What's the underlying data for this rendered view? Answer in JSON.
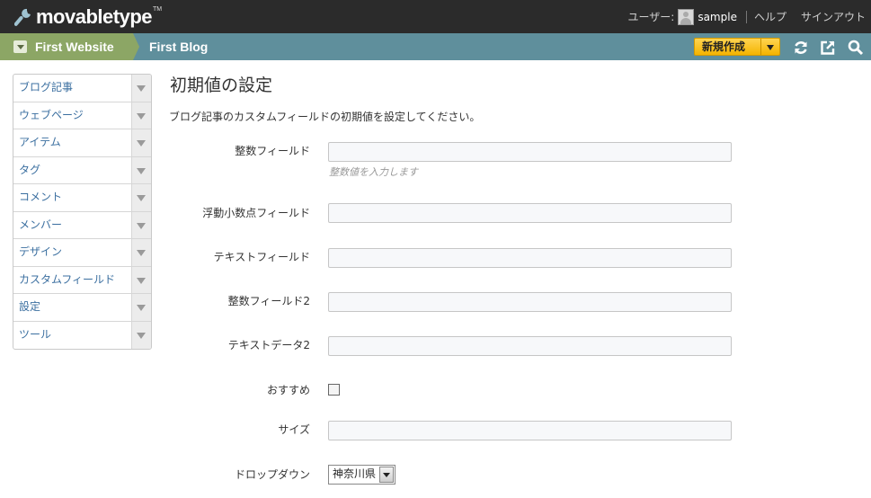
{
  "app": {
    "logo_text": "movabletype",
    "logo_tm": "TM"
  },
  "user_bar": {
    "user_label": "ユーザー:",
    "user_name": "sample",
    "help_label": "ヘルプ",
    "signout_label": "サインアウト"
  },
  "nav": {
    "website_name": "First Website",
    "blog_name": "First Blog",
    "new_button_label": "新規作成",
    "icons": [
      "refresh-icon",
      "external-link-icon",
      "search-icon"
    ],
    "colors": {
      "website_bg": "#8ca665",
      "blog_bg": "#5f8f9c",
      "new_button_bg": "#f4b400"
    }
  },
  "sidebar": {
    "items": [
      {
        "label": "ブログ記事"
      },
      {
        "label": "ウェブページ"
      },
      {
        "label": "アイテム"
      },
      {
        "label": "タグ"
      },
      {
        "label": "コメント"
      },
      {
        "label": "メンバー"
      },
      {
        "label": "デザイン"
      },
      {
        "label": "カスタムフィールド"
      },
      {
        "label": "設定"
      },
      {
        "label": "ツール"
      }
    ]
  },
  "main": {
    "title": "初期値の設定",
    "description": "ブログ記事のカスタムフィールドの初期値を設定してください。",
    "fields": {
      "integer": {
        "label": "整数フィールド",
        "value": "",
        "hint": "整数値を入力します"
      },
      "float": {
        "label": "浮動小数点フィールド",
        "value": ""
      },
      "text": {
        "label": "テキストフィールド",
        "value": ""
      },
      "integer2": {
        "label": "整数フィールド2",
        "value": ""
      },
      "textdata2": {
        "label": "テキストデータ2",
        "value": ""
      },
      "recommend": {
        "label": "おすすめ",
        "checked": false
      },
      "size": {
        "label": "サイズ",
        "value": ""
      },
      "dropdown": {
        "label": "ドロップダウン",
        "selected": "神奈川県"
      }
    }
  }
}
